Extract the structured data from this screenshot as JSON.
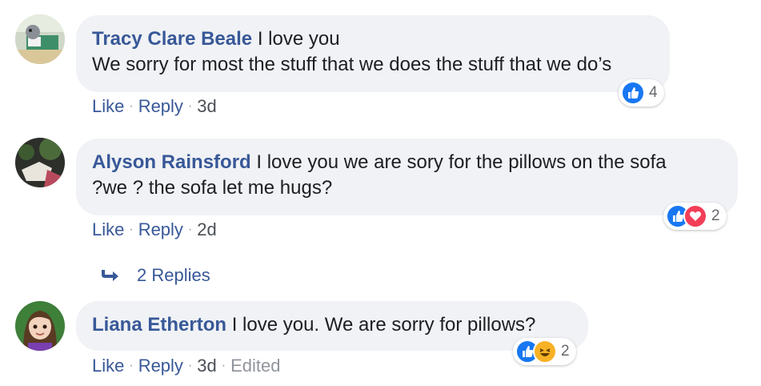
{
  "comments": [
    {
      "author": "Tracy Clare Beale",
      "text_line1": "I love you",
      "text_line2": "We sorry for most the stuff that we does the stuff that we do’s",
      "reaction_count": "4",
      "reactions": [
        "like-icon"
      ],
      "like": "Like",
      "reply": "Reply",
      "time": "3d"
    },
    {
      "author": "Alyson Rainsford",
      "text_line1": "I love you we are sory for the pillows on the sofa",
      "text_line2": "?we ? the sofa let me hugs?",
      "reaction_count": "2",
      "reactions": [
        "like-icon",
        "love-icon"
      ],
      "like": "Like",
      "reply": "Reply",
      "time": "2d",
      "replies_label": "2 Replies"
    },
    {
      "author": "Liana Etherton",
      "text_line1": "I love you. We are sorry for pillows?",
      "reaction_count": "2",
      "reactions": [
        "like-icon",
        "haha-icon"
      ],
      "like": "Like",
      "reply": "Reply",
      "time": "3d",
      "edited": "Edited"
    }
  ],
  "separator": "·",
  "colors": {
    "author": "#385898",
    "bubble": "#f0f2f5",
    "like_blue": "#1877f2",
    "love_red": "#f33e58",
    "haha_yellow": "#f7b125"
  }
}
